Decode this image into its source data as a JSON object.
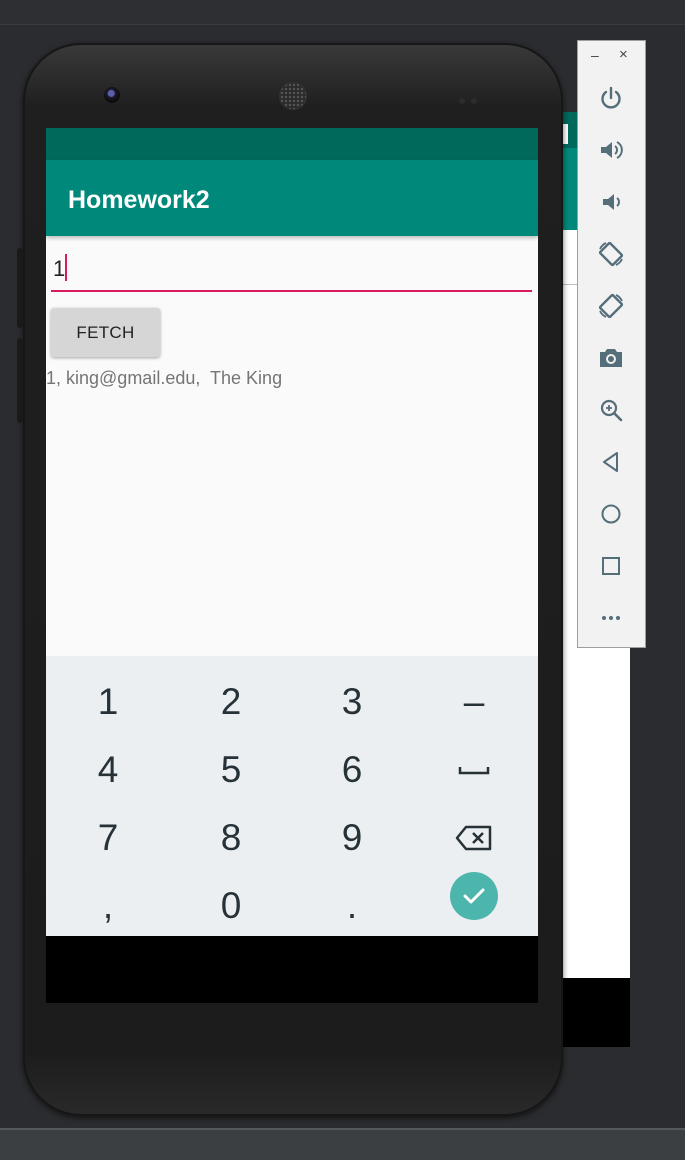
{
  "app": {
    "title": "Homework2"
  },
  "form": {
    "input_value": "1",
    "fetch_label": "FETCH",
    "result_text": "1, king@gmail.edu,  The King"
  },
  "keyboard": {
    "keys": [
      "1",
      "2",
      "3",
      "–",
      "4",
      "5",
      "6",
      "␣",
      "7",
      "8",
      "9",
      "⌫",
      ",",
      "0",
      "."
    ],
    "accent_color": "#4db6ac"
  },
  "emulator_toolbar": {
    "minimize_label": "–",
    "close_label": "×",
    "buttons": [
      "power-icon",
      "volume-up-icon",
      "volume-down-icon",
      "rotate-left-icon",
      "rotate-right-icon",
      "camera-icon",
      "zoom-icon",
      "back-icon",
      "home-icon",
      "overview-icon",
      "more-icon"
    ]
  },
  "colors": {
    "app_bar": "#00897b",
    "status_bar": "#00695c",
    "input_underline": "#d81b60"
  }
}
